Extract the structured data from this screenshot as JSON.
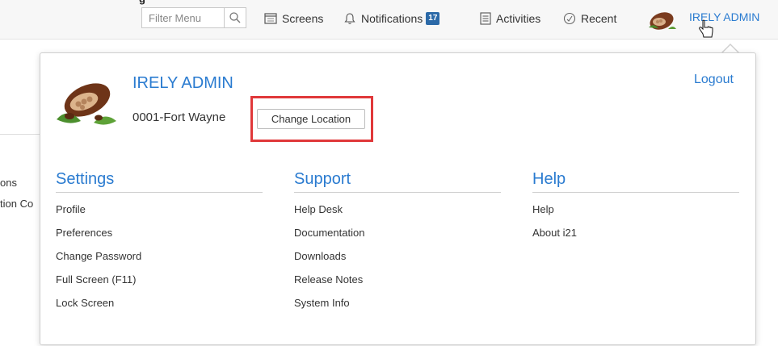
{
  "topbar": {
    "clipped_title": "g",
    "filter": {
      "placeholder": "Filter Menu"
    },
    "screens_label": "Screens",
    "notifications_label": "Notifications",
    "notifications_count": "17",
    "activities_label": "Activities",
    "recent_label": "Recent",
    "user_label": "IRELY ADMIN"
  },
  "background": {
    "line1": "ons",
    "line2": "tion Co"
  },
  "panel": {
    "user_name": "IRELY ADMIN",
    "location": "0001-Fort Wayne",
    "change_location_label": "Change Location",
    "logout_label": "Logout",
    "sections": [
      {
        "title": "Settings",
        "items": [
          "Profile",
          "Preferences",
          "Change Password",
          "Full Screen (F11)",
          "Lock Screen"
        ]
      },
      {
        "title": "Support",
        "items": [
          "Help Desk",
          "Documentation",
          "Downloads",
          "Release Notes",
          "System Info"
        ]
      },
      {
        "title": "Help",
        "items": [
          "Help",
          "About i21"
        ]
      }
    ]
  },
  "colors": {
    "accent": "#2a7bd0",
    "badge": "#2c6aa8",
    "highlight": "#e0383a"
  },
  "icons": [
    "search-icon",
    "screens-icon",
    "bell-icon",
    "activities-icon",
    "clock-icon",
    "user-avatar",
    "hand-cursor-icon"
  ]
}
